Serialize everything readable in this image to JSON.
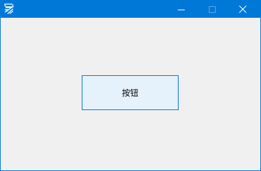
{
  "window": {
    "title": "",
    "icon": "app-logo-icon",
    "accent_color": "#0078d7",
    "background_color": "#f0f0f0"
  },
  "caption_buttons": {
    "minimize_icon": "minimize-icon",
    "maximize_icon": "maximize-icon",
    "close_icon": "close-icon"
  },
  "main": {
    "button_label": "按钮",
    "button_bg_color": "#e5f1fb",
    "button_border_color": "#0078d7"
  }
}
